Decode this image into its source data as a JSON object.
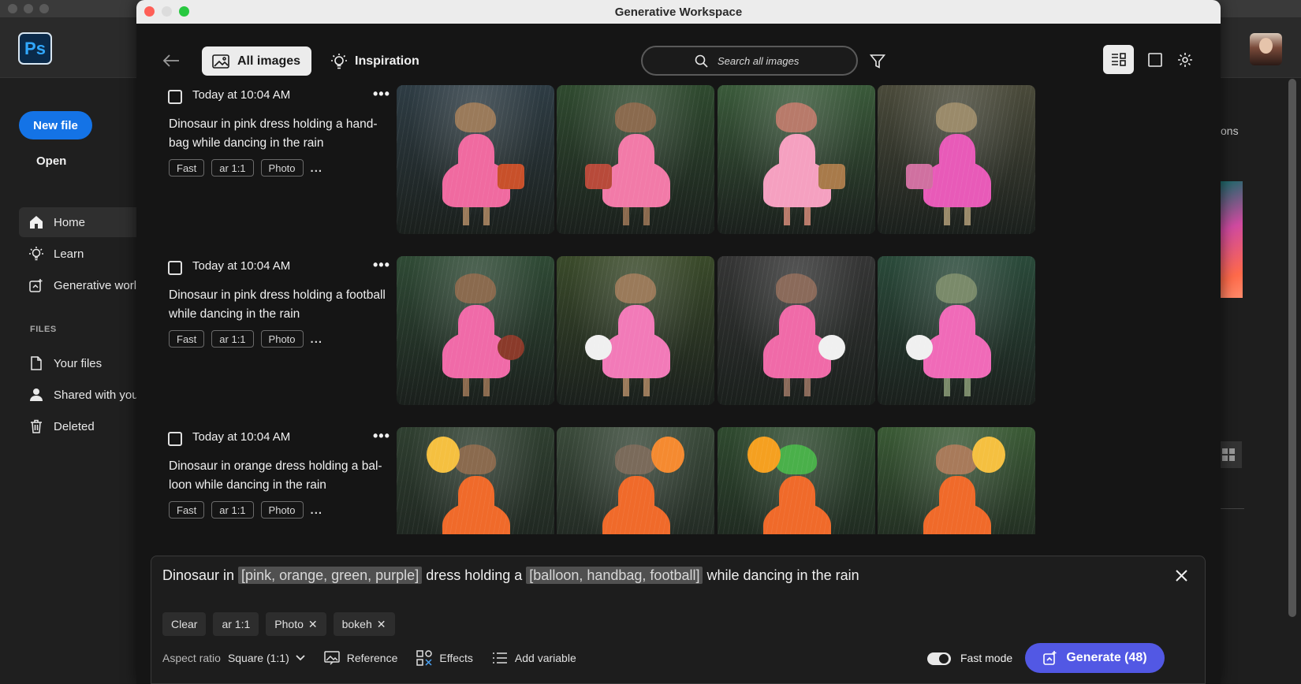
{
  "background_app": {
    "logo_text": "Ps",
    "new_file_label": "New file",
    "open_label": "Open",
    "nav": [
      {
        "label": "Home",
        "icon": "home-icon"
      },
      {
        "label": "Learn",
        "icon": "lightbulb-icon"
      },
      {
        "label": "Generative worl",
        "icon": "generative-workspace-icon"
      }
    ],
    "files_heading": "FILES",
    "files": [
      {
        "label": "Your files",
        "icon": "file-icon"
      },
      {
        "label": "Shared with you",
        "icon": "person-icon"
      },
      {
        "label": "Deleted",
        "icon": "trash-icon"
      }
    ],
    "right_partial_text": "ons"
  },
  "window": {
    "title": "Generative Workspace"
  },
  "toolbar": {
    "tab_all_images": "All images",
    "tab_inspiration": "Inspiration",
    "search_placeholder": "Search all images"
  },
  "generations": [
    {
      "time": "Today at 10:04 AM",
      "prompt": "Dinosaur in pink dress holding a hand-bag while dancing in the rain",
      "chips": [
        "Fast",
        "ar 1:1",
        "Photo"
      ],
      "more_chips": "...",
      "thumbs": [
        {
          "bg": "#2e3c44",
          "dress": "#f06aa0",
          "skin": "#9a7a5a",
          "prop": "#c8502a"
        },
        {
          "bg": "#2f4a2f",
          "dress": "#f27aa8",
          "skin": "#8a6a4e",
          "prop": "#b84a3a"
        },
        {
          "bg": "#3a5a3a",
          "dress": "#f5a0c0",
          "skin": "#b87a6a",
          "prop": "#a87a4a"
        },
        {
          "bg": "#4a4a3a",
          "dress": "#e85ab8",
          "skin": "#9a8a6a",
          "prop": "#d070a0"
        }
      ]
    },
    {
      "time": "Today at 10:04 AM",
      "prompt": "Dinosaur in pink dress holding a football while dancing in the rain",
      "chips": [
        "Fast",
        "ar 1:1",
        "Photo"
      ],
      "more_chips": "...",
      "thumbs": [
        {
          "bg": "#2f4a35",
          "dress": "#f06aa8",
          "skin": "#8a6a4e",
          "prop": "#8a3a2a"
        },
        {
          "bg": "#3a4a2a",
          "dress": "#f27ab8",
          "skin": "#9a7a5a",
          "prop": "#f0f0f0"
        },
        {
          "bg": "#353535",
          "dress": "#f06aa8",
          "skin": "#8a6a5a",
          "prop": "#f0f0f0"
        },
        {
          "bg": "#2a4a3a",
          "dress": "#f06ab8",
          "skin": "#7a8a6a",
          "prop": "#f0f0f0"
        }
      ]
    },
    {
      "time": "Today at 10:04 AM",
      "prompt": "Dinosaur in orange dress holding a bal-loon while dancing in the rain",
      "chips": [
        "Fast",
        "ar 1:1",
        "Photo"
      ],
      "more_chips": "...",
      "thumbs": [
        {
          "bg": "#2f3f30",
          "dress": "#f06a2a",
          "skin": "#8a6a4e",
          "prop": "#f5c040"
        },
        {
          "bg": "#3a4a3a",
          "dress": "#f06a2a",
          "skin": "#7a6a5a",
          "prop": "#f58a30"
        },
        {
          "bg": "#2f4a2f",
          "dress": "#f06a2a",
          "skin": "#4ab04a",
          "prop": "#f5a020"
        },
        {
          "bg": "#3a5a35",
          "dress": "#f06a2a",
          "skin": "#a87a5a",
          "prop": "#f5c040"
        }
      ]
    }
  ],
  "composer": {
    "prompt_parts": [
      "Dinosaur in ",
      "[pink, orange, green, purple]",
      " dress holding a ",
      "[balloon, handbag, football]",
      " while dancing in the rain"
    ],
    "chips": [
      {
        "label": "Clear",
        "removable": false
      },
      {
        "label": "ar 1:1",
        "removable": false
      },
      {
        "label": "Photo",
        "removable": true
      },
      {
        "label": "bokeh",
        "removable": true
      }
    ],
    "aspect_ratio_label": "Aspect ratio",
    "aspect_ratio_value": "Square (1:1)",
    "reference_label": "Reference",
    "effects_label": "Effects",
    "add_variable_label": "Add variable",
    "fast_mode_label": "Fast mode",
    "fast_mode_on": true,
    "generate_label": "Generate (48)"
  },
  "colors": {
    "accent_blue": "#1473e6",
    "generate_purple": "#5258e4"
  }
}
